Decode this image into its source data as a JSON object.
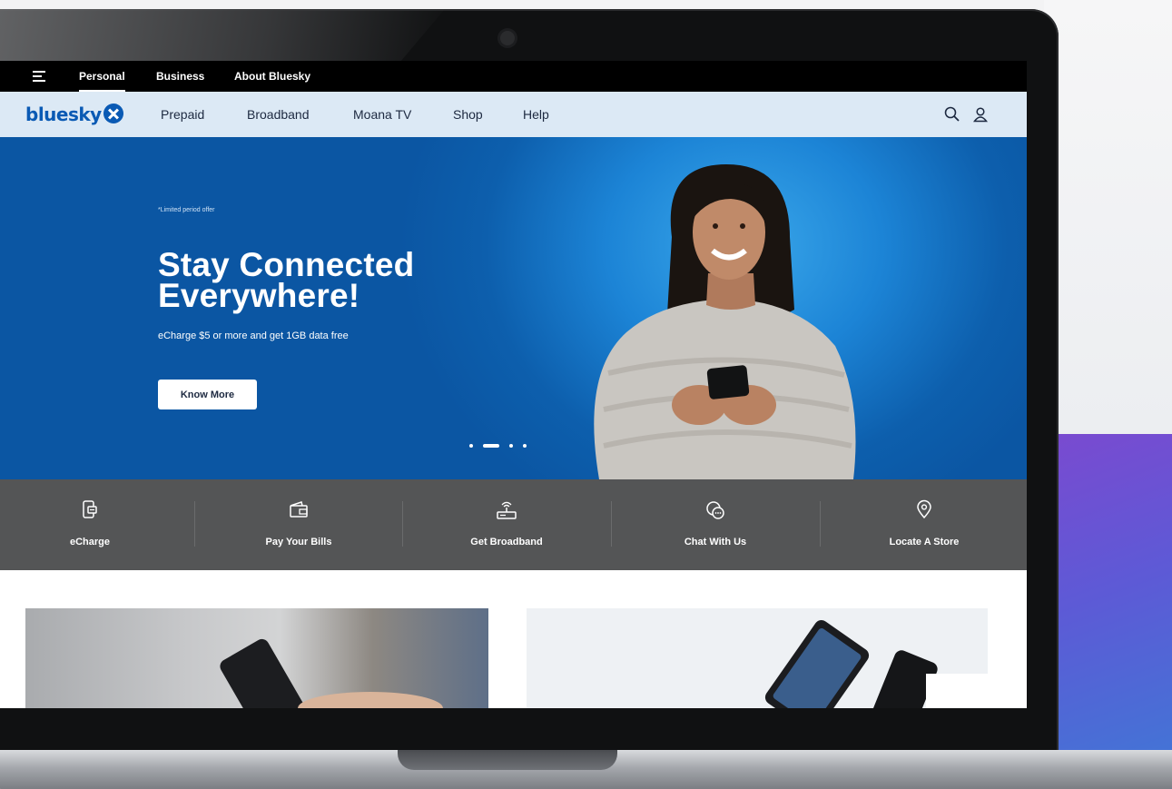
{
  "top_bar": {
    "links": [
      "Personal",
      "Business",
      "About Bluesky"
    ]
  },
  "nav": {
    "logo": "bluesky",
    "links": [
      "Prepaid",
      "Broadband",
      "Moana TV",
      "Shop",
      "Help"
    ]
  },
  "hero": {
    "fine_print": "*Limited period offer",
    "title_line1": "Stay Connected",
    "title_line2": "Everywhere!",
    "subtitle": "eCharge $5 or more and get 1GB data free",
    "button": "Know More",
    "slides_total": 4,
    "slide_active": 2
  },
  "quick_actions": [
    {
      "label": "eCharge",
      "icon": "echarge-icon"
    },
    {
      "label": "Pay Your Bills",
      "icon": "wallet-icon"
    },
    {
      "label": "Get Broadband",
      "icon": "router-icon"
    },
    {
      "label": "Chat With Us",
      "icon": "chat-icon"
    },
    {
      "label": "Locate A Store",
      "icon": "location-pin-icon"
    }
  ],
  "colors": {
    "brand_blue": "#0a5ab4",
    "nav_bg": "#dce9f5",
    "quick_bar_bg": "#545556",
    "accent_purple": "#7a4ad0"
  }
}
